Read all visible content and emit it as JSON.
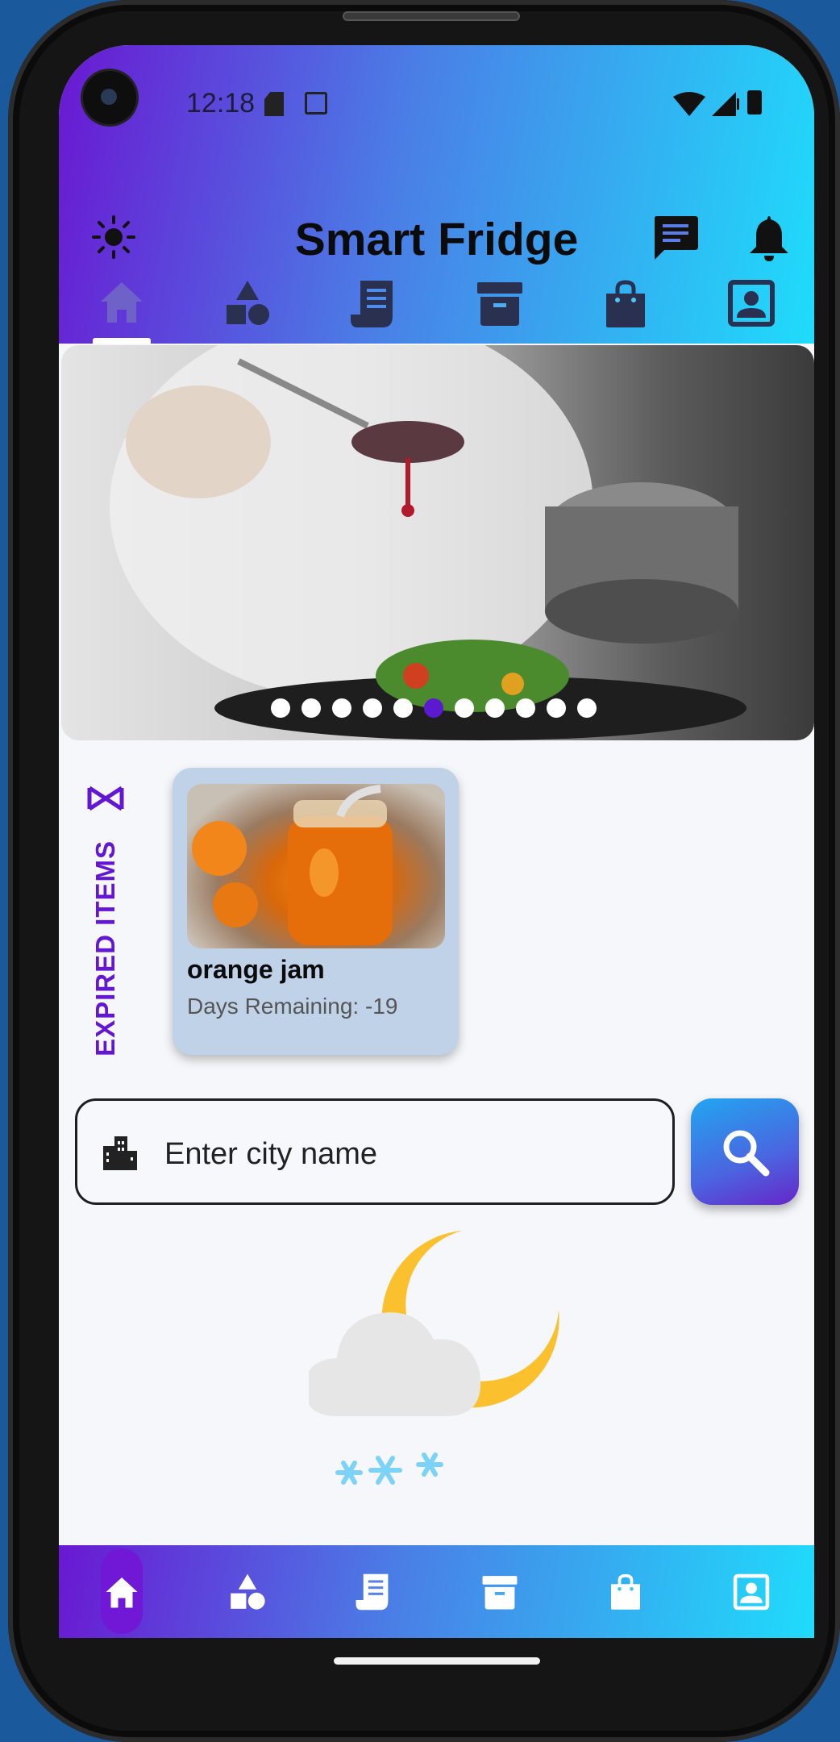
{
  "status_bar": {
    "time": "12:18"
  },
  "app_bar": {
    "title": "Smart Fridge"
  },
  "top_tabs": [
    {
      "name": "home",
      "active": true
    },
    {
      "name": "categories",
      "active": false
    },
    {
      "name": "recipes",
      "active": false
    },
    {
      "name": "storage",
      "active": false
    },
    {
      "name": "shopping",
      "active": false
    },
    {
      "name": "profile",
      "active": false
    }
  ],
  "carousel": {
    "slide_count": 11,
    "active_index": 5
  },
  "expired": {
    "label": "EXPIRED ITEMS",
    "items": [
      {
        "name": "orange jam",
        "days_text": "Days Remaining: -19"
      }
    ]
  },
  "search": {
    "placeholder": "Enter city name",
    "value": ""
  },
  "weather": {
    "icon": "cloud-moon-snow-icon"
  },
  "colors": {
    "accent": "#6417d2",
    "gradient_start": "#6a18d2",
    "gradient_end": "#1fdcfb",
    "moon": "#fbc02d",
    "snow": "#7dd3f7"
  }
}
